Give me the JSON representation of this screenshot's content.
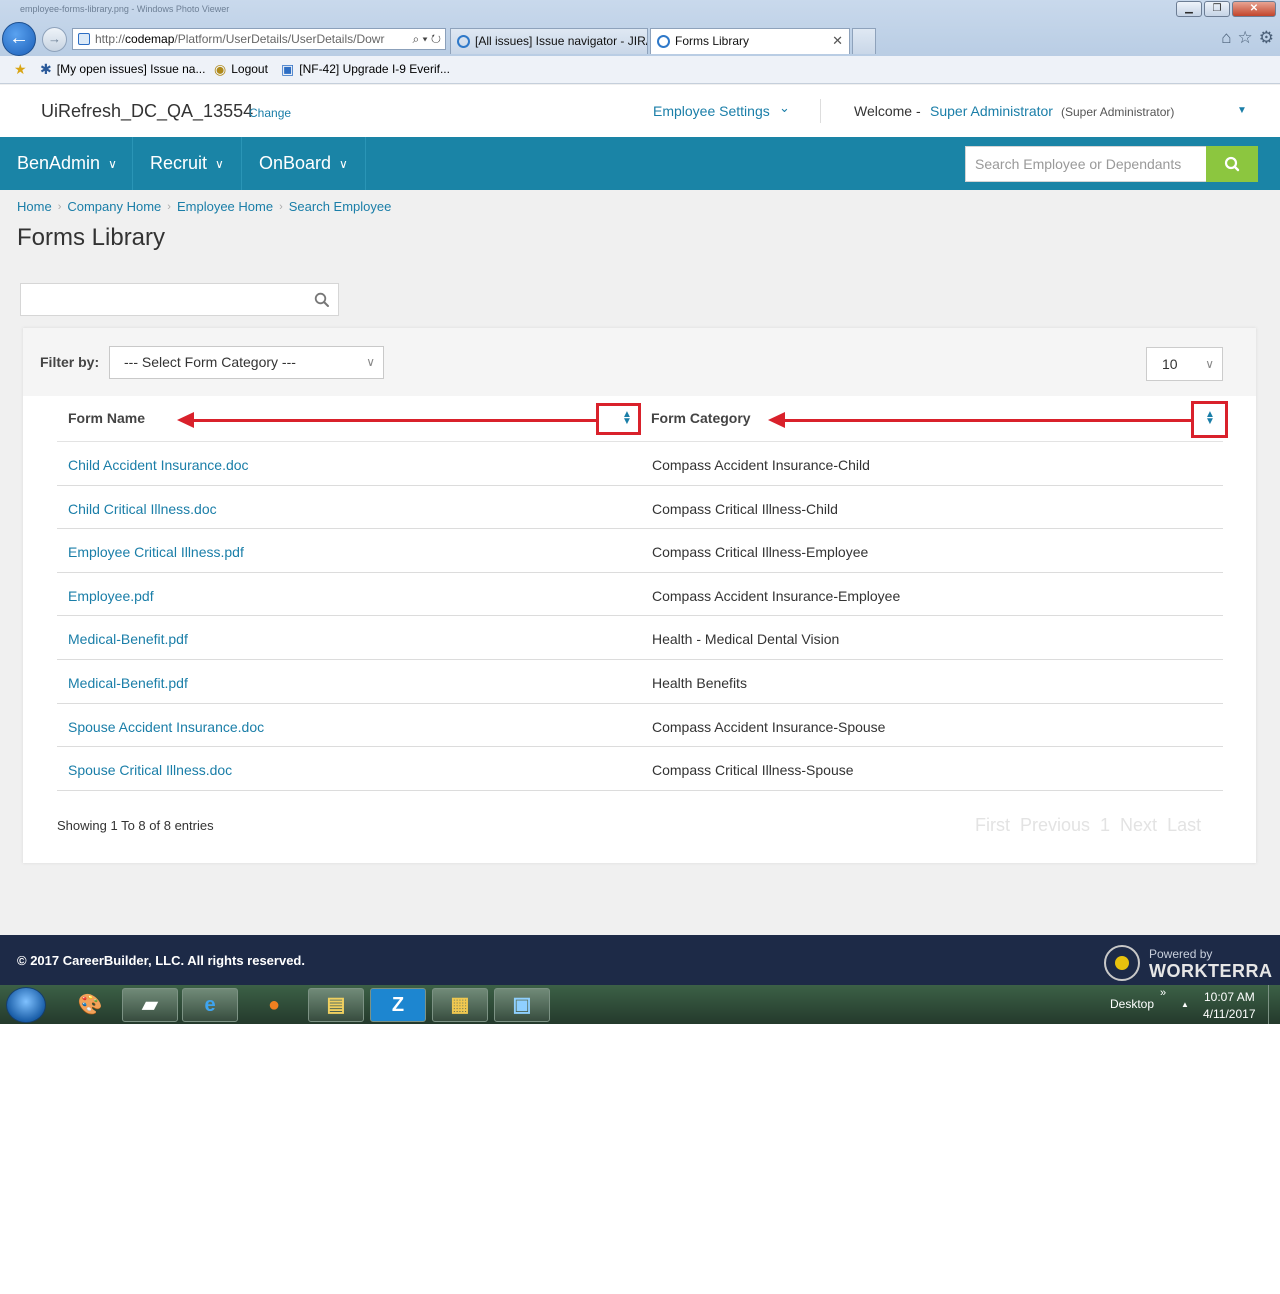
{
  "browser": {
    "window_ghost_title": "employee-forms-library.png - Windows Photo Viewer",
    "url_scheme": "http://",
    "url_host": "codemap",
    "url_path": "/Platform/UserDetails/UserDetails/Dowr",
    "tabs": [
      {
        "label": "[All issues] Issue navigator - JIRA"
      },
      {
        "label": "Forms Library"
      }
    ],
    "favorites": [
      {
        "label": "[My open issues] Issue na..."
      },
      {
        "label": "Logout"
      },
      {
        "label": "[NF-42] Upgrade I-9 Everif..."
      }
    ]
  },
  "header": {
    "client_name": "UiRefresh_DC_QA_13554",
    "change_label": "Change",
    "employee_settings": "Employee Settings",
    "welcome": "Welcome -",
    "user_name": "Super Administrator",
    "user_role": "(Super Administrator)"
  },
  "nav": {
    "items": [
      {
        "label": "BenAdmin"
      },
      {
        "label": "Recruit"
      },
      {
        "label": "OnBoard"
      }
    ],
    "search_placeholder": "Search Employee or Dependants"
  },
  "breadcrumb": [
    "Home",
    "Company Home",
    "Employee Home",
    "Search Employee"
  ],
  "page_title": "Forms Library",
  "filter": {
    "label": "Filter by:",
    "category_value": "--- Select Form Category ---",
    "page_size": "10"
  },
  "table": {
    "columns": [
      "Form Name",
      "Form Category"
    ],
    "rows": [
      {
        "name": "Child Accident Insurance.doc",
        "category": "Compass Accident Insurance-Child"
      },
      {
        "name": "Child Critical Illness.doc",
        "category": "Compass Critical Illness-Child"
      },
      {
        "name": "Employee Critical Illness.pdf",
        "category": "Compass Critical Illness-Employee"
      },
      {
        "name": "Employee.pdf",
        "category": "Compass Accident Insurance-Employee"
      },
      {
        "name": "Medical-Benefit.pdf",
        "category": "Health - Medical Dental Vision"
      },
      {
        "name": "Medical-Benefit.pdf",
        "category": "Health Benefits"
      },
      {
        "name": "Spouse Accident Insurance.doc",
        "category": "Compass Accident Insurance-Spouse"
      },
      {
        "name": "Spouse Critical Illness.doc",
        "category": "Compass Critical Illness-Spouse"
      }
    ]
  },
  "showing": "Showing 1 To 8 of 8 entries",
  "pager": {
    "first": "First",
    "previous": "Previous",
    "current": "1",
    "next": "Next",
    "last": "Last"
  },
  "footer": {
    "copyright": "© 2017 CareerBuilder, LLC. All rights reserved.",
    "powered_by": "Powered by",
    "brand": "WORKTERRA"
  },
  "taskbar": {
    "z_label": "Z",
    "desktop": "Desktop",
    "time": "10:07 AM",
    "date": "4/11/2017"
  },
  "colors": {
    "accent": "#1a84a6",
    "link": "#1a7ea8",
    "search_button": "#8cc63f",
    "footer": "#1d2a47",
    "annotation": "#d9212b"
  },
  "icons": [
    "back-arrow-icon",
    "forward-arrow-icon",
    "search-icon",
    "chevron-down-icon",
    "sort-icon",
    "home-icon",
    "star-icon",
    "gear-icon"
  ]
}
